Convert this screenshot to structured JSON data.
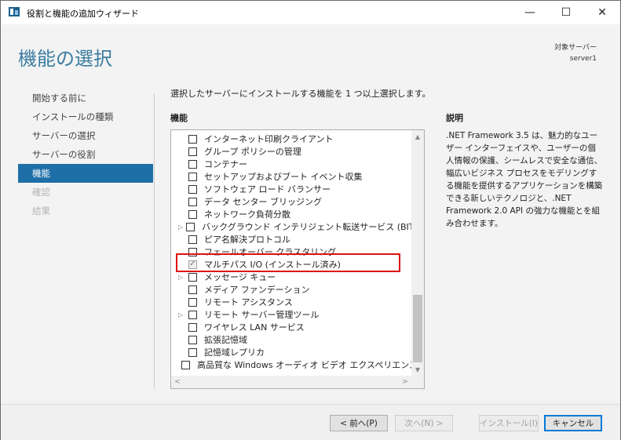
{
  "window": {
    "title": "役割と機能の追加ウィザード",
    "controls": {
      "minimize": "—",
      "maximize": "☐",
      "close": "✕"
    }
  },
  "header": {
    "page_title": "機能の選択",
    "target_server_label": "対象サーバー",
    "target_server_name": "server1"
  },
  "sidebar": {
    "items": [
      {
        "label": "開始する前に",
        "state": "normal"
      },
      {
        "label": "インストールの種類",
        "state": "normal"
      },
      {
        "label": "サーバーの選択",
        "state": "normal"
      },
      {
        "label": "サーバーの役割",
        "state": "normal"
      },
      {
        "label": "機能",
        "state": "active"
      },
      {
        "label": "確認",
        "state": "disabled"
      },
      {
        "label": "結果",
        "state": "disabled"
      }
    ]
  },
  "main": {
    "instruction": "選択したサーバーにインストールする機能を 1 つ以上選択します。",
    "features_heading": "機能",
    "features": [
      {
        "label": "インターネット印刷クライアント",
        "checked": false,
        "expandable": false
      },
      {
        "label": "グループ ポリシーの管理",
        "checked": false,
        "expandable": false
      },
      {
        "label": "コンテナー",
        "checked": false,
        "expandable": false
      },
      {
        "label": "セットアップおよびブート イベント収集",
        "checked": false,
        "expandable": false
      },
      {
        "label": "ソフトウェア ロード バランサー",
        "checked": false,
        "expandable": false
      },
      {
        "label": "データ センター ブリッジング",
        "checked": false,
        "expandable": false
      },
      {
        "label": "ネットワーク負荷分散",
        "checked": false,
        "expandable": false
      },
      {
        "label": "バックグラウンド インテリジェント転送サービス (BITS)",
        "checked": false,
        "expandable": true
      },
      {
        "label": "ピア名解決プロトコル",
        "checked": false,
        "expandable": false
      },
      {
        "label": "フェールオーバー クラスタリング",
        "checked": false,
        "expandable": false
      },
      {
        "label": "マルチパス I/O (インストール済み)",
        "checked": true,
        "expandable": false,
        "installed": true
      },
      {
        "label": "メッセージ キュー",
        "checked": false,
        "expandable": true
      },
      {
        "label": "メディア ファンデーション",
        "checked": false,
        "expandable": false
      },
      {
        "label": "リモート アシスタンス",
        "checked": false,
        "expandable": false
      },
      {
        "label": "リモート サーバー管理ツール",
        "checked": false,
        "expandable": true
      },
      {
        "label": "ワイヤレス LAN サービス",
        "checked": false,
        "expandable": false
      },
      {
        "label": "拡張記憶域",
        "checked": false,
        "expandable": false
      },
      {
        "label": "記憶域レプリカ",
        "checked": false,
        "expandable": false
      },
      {
        "label": "高品質な Windows オーディオ ビデオ エクスペリエンス",
        "checked": false,
        "expandable": false
      }
    ],
    "scroll_glyphs": {
      "up": "▲",
      "down": "▼",
      "left": "<",
      "right": ">"
    }
  },
  "description": {
    "heading": "説明",
    "text": ".NET Framework 3.5 は、魅力的なユーザー インターフェイスや、ユーザーの個人情報の保護、シームレスで安全な通信、幅広いビジネス プロセスをモデリングする機能を提供するアプリケーションを構築できる新しいテクノロジと、.NET Framework 2.0 API の強力な機能とを組み合わせます。"
  },
  "footer": {
    "prev_label": "< 前へ(P)",
    "next_label": "次へ(N) >",
    "install_label": "インストール(I)",
    "cancel_label": "キャンセル"
  },
  "colors": {
    "accent": "#1e6ea7",
    "title": "#3b7ca0",
    "highlight": "#e01010"
  }
}
